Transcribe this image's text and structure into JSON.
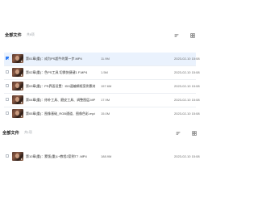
{
  "panels": [
    {
      "title": "全部文件",
      "count": "共6项",
      "files": [
        {
          "name": "第01章(重)：成为PS超牛的第一步.MP4",
          "size": "11.9M",
          "date": "2023-02-10 15:08",
          "selected": true
        },
        {
          "name": "第02章(重)：色PS工具  切换快捷键1 F.MP4",
          "size": "1.5M",
          "date": "2023-02-10 15:08",
          "selected": false
        },
        {
          "name": "第03章(重)：PS界面设置：ID0速编辑框案例素材.MP4",
          "size": "157.6M",
          "date": "2023-02-10 15:08",
          "selected": false
        },
        {
          "name": "第04章(重)：修补工具、磨皮工具、调整图层.MP4",
          "size": "17.9M",
          "date": "2023-02-10 15:08",
          "selected": false
        },
        {
          "name": "第05章(重)：图像基础_RGB通道、图像色彩.mp4",
          "size": "15.0M",
          "date": "2023-02-10 15:08",
          "selected": false
        }
      ]
    },
    {
      "title": "全部文件",
      "count": "共1项",
      "files": [
        {
          "name": "第10章(重)：蒙版(重)1+教程2案例T7 .MP4",
          "size": "188.9M",
          "date": "2023-02-10 15:08",
          "selected": false
        }
      ]
    }
  ],
  "icons": {
    "sort": "sort-icon",
    "grid": "grid-view-icon"
  },
  "colors": {
    "accent": "#2f7cf6",
    "selected_row": "#eaf2fd"
  }
}
